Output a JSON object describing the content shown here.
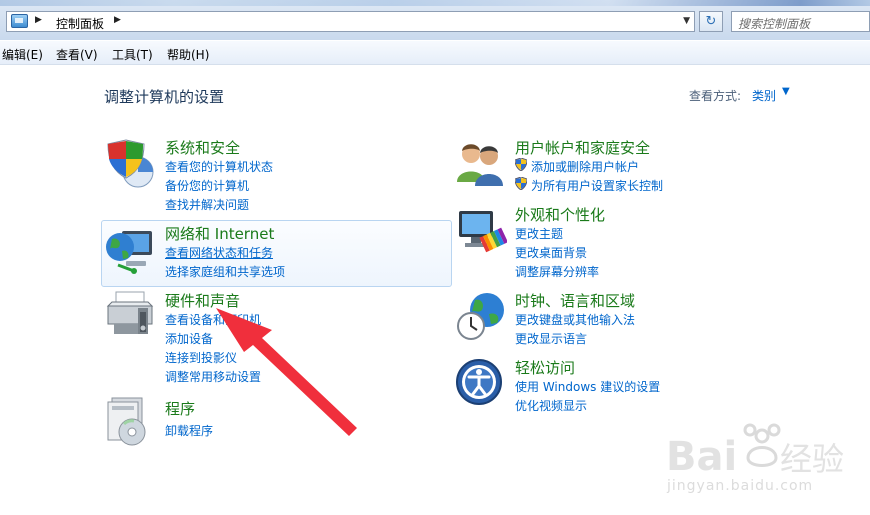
{
  "address": {
    "breadcrumb": "控制面板",
    "search_placeholder": "搜索控制面板"
  },
  "menu": [
    "编辑(E)",
    "查看(V)",
    "工具(T)",
    "帮助(H)"
  ],
  "page": {
    "title": "调整计算机的设置",
    "view_by_label": "查看方式:",
    "view_by_value": "类别"
  },
  "categories_left": [
    {
      "title": "系统和安全",
      "icon": "shield-icon",
      "links": [
        "查看您的计算机状态",
        "备份您的计算机",
        "查找并解决问题"
      ]
    },
    {
      "title": "网络和 Internet",
      "icon": "network-globe-icon",
      "links": [
        "查看网络状态和任务",
        "选择家庭组和共享选项"
      ]
    },
    {
      "title": "硬件和声音",
      "icon": "printer-icon",
      "links": [
        "查看设备和打印机",
        "添加设备",
        "连接到投影仪",
        "调整常用移动设置"
      ]
    },
    {
      "title": "程序",
      "icon": "programs-icon",
      "links": [
        "卸载程序"
      ]
    }
  ],
  "categories_right": [
    {
      "title": "用户帐户和家庭安全",
      "icon": "users-icon",
      "links": [
        "添加或删除用户帐户",
        "为所有用户设置家长控制"
      ]
    },
    {
      "title": "外观和个性化",
      "icon": "monitor-palette-icon",
      "links": [
        "更改主题",
        "更改桌面背景",
        "调整屏幕分辨率"
      ]
    },
    {
      "title": "时钟、语言和区域",
      "icon": "clock-globe-icon",
      "links": [
        "更改键盘或其他输入法",
        "更改显示语言"
      ]
    },
    {
      "title": "轻松访问",
      "icon": "accessibility-icon",
      "links": [
        "使用 Windows 建议的设置",
        "优化视频显示"
      ]
    }
  ],
  "watermark": {
    "text": "jingyan.baidu.com"
  },
  "colors": {
    "link": "#0066cc",
    "category_title": "#1a7a1a",
    "arrow": "#f02f3c"
  }
}
